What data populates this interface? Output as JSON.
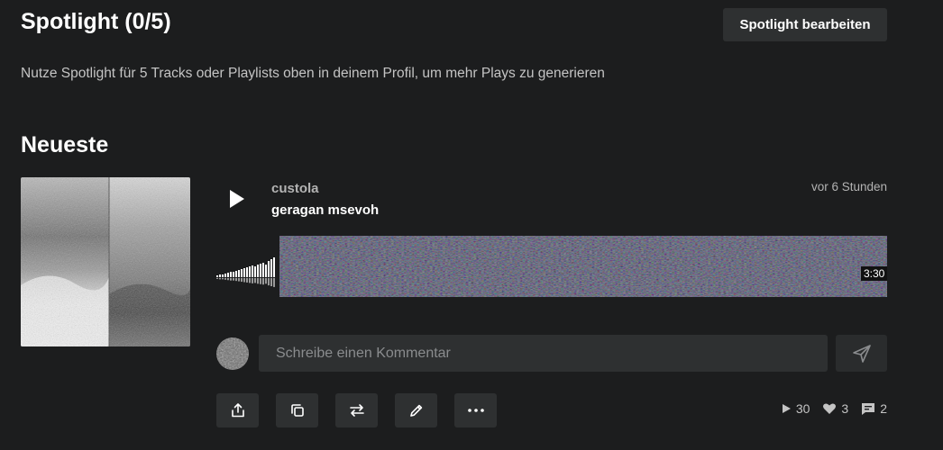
{
  "spotlight": {
    "title": "Spotlight (0/5)",
    "edit_label": "Spotlight bearbeiten",
    "description": "Nutze Spotlight für 5 Tracks oder Playlists oben in deinem Profil, um mehr Plays zu generieren"
  },
  "latest": {
    "title": "Neueste",
    "track": {
      "user": "custola",
      "title": "geragan msevoh",
      "posted": "vor 6 Stunden",
      "duration": "3:30",
      "comment_placeholder": "Schreibe einen Kommentar",
      "stats": {
        "plays": "30",
        "likes": "3",
        "comments": "2"
      }
    }
  },
  "icons": {
    "play": "play-icon",
    "send": "send-icon",
    "share": "share-icon",
    "copy": "copy-icon",
    "repost": "repost-icon",
    "edit": "pencil-icon",
    "more": "more-icon"
  },
  "colors": {
    "background": "#1c1d1e",
    "button": "#2e3031",
    "text_muted": "#b3b3b3"
  }
}
